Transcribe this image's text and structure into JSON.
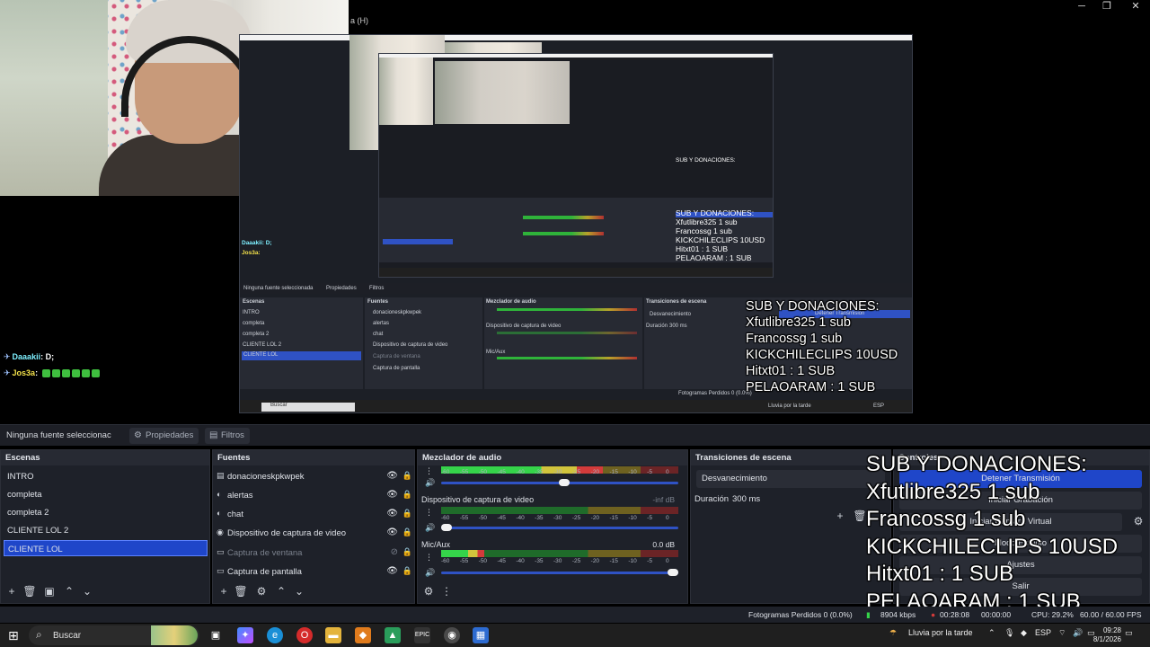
{
  "window": {
    "caption": "a (H)",
    "minimize": "─",
    "maximize": "❐",
    "close": "✕"
  },
  "chat": [
    {
      "user": "Daaakii",
      "message": "D;"
    },
    {
      "user": "Jos3a",
      "message": ""
    }
  ],
  "nested_preview": {
    "caption": "a (H)",
    "chat_user1": "Daaakii: D;",
    "chat_user2": "Jos3a:",
    "context_label": "Ninguna fuente seleccionada",
    "properties": "Propiedades",
    "filters": "Filtros",
    "scenes_title": "Escenas",
    "scenes": [
      "INTRO",
      "completa",
      "completa 2",
      "CLIENTE LOL 2",
      "CLIENTE LOL"
    ],
    "sources_title": "Fuentes",
    "sources": [
      "donacioneskpkwpek",
      "alertas",
      "chat",
      "Dispositivo de captura de video",
      "Captura de ventana",
      "Captura de pantalla"
    ],
    "mixer_title": "Mezclador de audio",
    "mixer_items": [
      "Dispositivo de captura de video",
      "Mic/Aux"
    ],
    "transitions_title": "Transiciones de escena",
    "transition": "Desvanecimiento",
    "duration_label": "Duración",
    "duration": "300 ms",
    "controls_button": "Detener Transmisión",
    "search": "Buscar",
    "weather": "Lluvia por la tarde",
    "lang": "ESP",
    "status": "Fotogramas Perdidos 0 (0.0%)"
  },
  "donations": {
    "title": "SUB Y DONACIONES:",
    "lines": [
      "Xfutlibre325 1 sub",
      "Francossg 1 sub",
      "KICKCHILECLIPS 10USD",
      "Hitxt01 : 1 SUB",
      "PELAOARAM : 1 SUB"
    ]
  },
  "context_bar": {
    "label": "Ninguna fuente seleccionac",
    "properties": "Propiedades",
    "filters": "Filtros"
  },
  "scenes": {
    "title": "Escenas",
    "items": [
      "INTRO",
      "completa",
      "completa 2",
      "CLIENTE LOL 2",
      "CLIENTE LOL"
    ],
    "selected_index": 4
  },
  "sources": {
    "title": "Fuentes",
    "items": [
      {
        "label": "donacioneskpkwpek",
        "icon": "text-icon",
        "visible": true
      },
      {
        "label": "alertas",
        "icon": "browser-icon",
        "visible": true
      },
      {
        "label": "chat",
        "icon": "browser-icon",
        "visible": true
      },
      {
        "label": "Dispositivo de captura de video",
        "icon": "camera-icon",
        "visible": true
      },
      {
        "label": "Captura de ventana",
        "icon": "window-icon",
        "visible": false
      },
      {
        "label": "Captura de pantalla",
        "icon": "monitor-icon",
        "visible": true
      }
    ]
  },
  "mixer": {
    "title": "Mezclador de audio",
    "ticks": [
      "-60",
      "-55",
      "-50",
      "-45",
      "-40",
      "-35",
      "-30",
      "-25",
      "-20",
      "-15",
      "-10",
      "-5",
      "0"
    ],
    "channels": [
      {
        "name": "",
        "db": "",
        "level": 0.68,
        "volume": 0.52
      },
      {
        "name": "Dispositivo de captura de video",
        "db": "-inf dB",
        "level": 0.0,
        "volume": 0.0
      },
      {
        "name": "Mic/Aux",
        "db": "0.0 dB",
        "level": 0.18,
        "volume": 1.0
      }
    ]
  },
  "transitions": {
    "title": "Transiciones de escena",
    "type": "Desvanecimiento",
    "duration_label": "Duración",
    "duration_value": "300 ms"
  },
  "controls": {
    "title": "Controles",
    "buttons": [
      "Detener Transmisión",
      "Iniciar Grabación",
      "Iniciar Cámara Virtual",
      "Modo Estudio",
      "Ajustes",
      "Salir"
    ]
  },
  "status": {
    "dropped": "Fotogramas Perdidos 0 (0.0%)",
    "bitrate": "8904 kbps",
    "live_time": "00:28:08",
    "rec_time": "00:00:00",
    "cpu": "CPU: 29.2%",
    "fps": "60.00 / 60.00 FPS"
  },
  "taskbar": {
    "search_placeholder": "Buscar",
    "weather": "Lluvia por la tarde",
    "lang": "ESP",
    "time": "09:28",
    "date": "8/1/2026"
  }
}
